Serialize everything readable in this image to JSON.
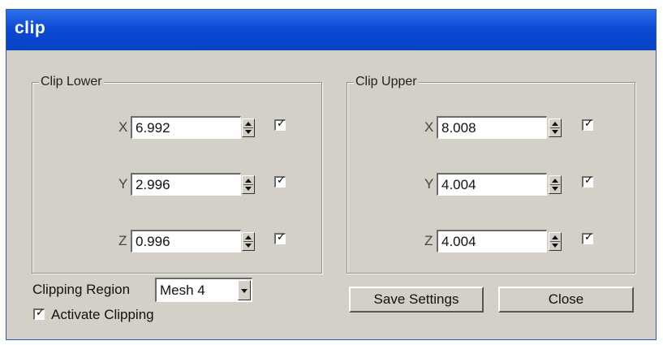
{
  "window": {
    "title": "clip"
  },
  "clip_lower": {
    "legend": "Clip Lower",
    "rows": [
      {
        "axis": "X",
        "value": "6.992",
        "checked": true
      },
      {
        "axis": "Y",
        "value": "2.996",
        "checked": true
      },
      {
        "axis": "Z",
        "value": "0.996",
        "checked": true
      }
    ]
  },
  "clip_upper": {
    "legend": "Clip Upper",
    "rows": [
      {
        "axis": "X",
        "value": "8.008",
        "checked": true
      },
      {
        "axis": "Y",
        "value": "4.004",
        "checked": true
      },
      {
        "axis": "Z",
        "value": "4.004",
        "checked": true
      }
    ]
  },
  "clipping_region": {
    "label": "Clipping Region",
    "selected": "Mesh 4"
  },
  "activate_clipping": {
    "label": "Activate Clipping",
    "checked": true
  },
  "buttons": {
    "save": "Save Settings",
    "close": "Close"
  },
  "check_glyph": "✓"
}
